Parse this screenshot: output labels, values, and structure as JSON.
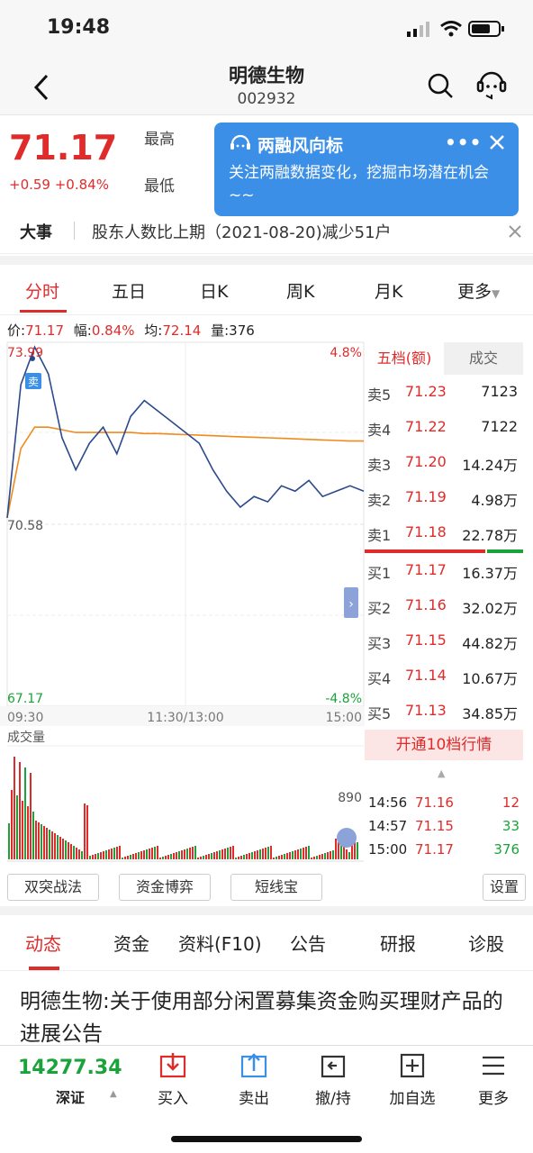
{
  "status_bar": {
    "time": "19:48"
  },
  "header": {
    "name": "明德生物",
    "code": "002932"
  },
  "quote": {
    "price": "71.17",
    "change": "+0.59 +0.84%",
    "high_label": "最高",
    "low_label": "最低"
  },
  "popup": {
    "title": "两融风向标",
    "text": "关注两融数据变化，挖掘市场潜在机会~~"
  },
  "news_bar": {
    "tag": "大事",
    "text": "股东人数比上期（2021-08-20)减少51户"
  },
  "chart_tabs": [
    "分时",
    "五日",
    "日K",
    "周K",
    "月K",
    "更多"
  ],
  "info_line": {
    "price_label": "价:",
    "price": "71.17",
    "amp_label": "幅:",
    "amp": "0.84%",
    "avg_label": "均:",
    "avg": "72.14",
    "vol_label": "量:",
    "vol": "376"
  },
  "chart": {
    "y_max": "73.99",
    "y_mid": "70.58",
    "y_min": "67.17",
    "pct_max": "4.8%",
    "pct_min": "-4.8%",
    "x_start": "09:30",
    "x_mid": "11:30/13:00",
    "x_end": "15:00",
    "sell_marker": "卖",
    "volume_label": "成交量",
    "volume_max": "890",
    "colors": {
      "price_line": "#2b4a8c",
      "avg_line": "#f08a1e",
      "up": "#e02b2b",
      "down": "#1aa33a"
    }
  },
  "chart_data": {
    "type": "line",
    "x_range": [
      "09:30",
      "15:00"
    ],
    "ylim": [
      67.17,
      73.99
    ],
    "series": [
      {
        "values": [
          70.7,
          73.2,
          73.9,
          73.4,
          72.2,
          71.6,
          72.1,
          72.4,
          71.9,
          72.6,
          72.9,
          72.7,
          72.5,
          72.3,
          72.1,
          71.6,
          71.2,
          70.9,
          71.1,
          71.0,
          71.3,
          71.2,
          71.4,
          71.1,
          71.2,
          71.3,
          71.2
        ]
      },
      {
        "values": [
          70.7,
          72.0,
          72.4,
          72.4,
          72.35,
          72.3,
          72.3,
          72.3,
          72.3,
          72.3,
          72.28,
          72.28,
          72.27,
          72.26,
          72.25,
          72.24,
          72.23,
          72.22,
          72.21,
          72.2,
          72.19,
          72.18,
          72.17,
          72.16,
          72.15,
          72.14,
          72.14
        ]
      }
    ]
  },
  "order_book": {
    "tab_active": "五档(额)",
    "tab_other": "成交",
    "sells": [
      {
        "label": "卖5",
        "price": "71.23",
        "volume": "7123"
      },
      {
        "label": "卖4",
        "price": "71.22",
        "volume": "7122"
      },
      {
        "label": "卖3",
        "price": "71.20",
        "volume": "14.24万"
      },
      {
        "label": "卖2",
        "price": "71.19",
        "volume": "4.98万"
      },
      {
        "label": "卖1",
        "price": "71.18",
        "volume": "22.78万"
      }
    ],
    "buys": [
      {
        "label": "买1",
        "price": "71.17",
        "volume": "16.37万"
      },
      {
        "label": "买2",
        "price": "71.16",
        "volume": "32.02万"
      },
      {
        "label": "买3",
        "price": "71.15",
        "volume": "44.82万"
      },
      {
        "label": "买4",
        "price": "71.14",
        "volume": "10.67万"
      },
      {
        "label": "买5",
        "price": "71.13",
        "volume": "34.85万"
      }
    ],
    "open10": "开通10档行情",
    "ticks": [
      {
        "time": "14:56",
        "price": "71.16",
        "volume": "12",
        "dir": "up"
      },
      {
        "time": "14:57",
        "price": "71.15",
        "volume": "33",
        "dir": "down"
      },
      {
        "time": "15:00",
        "price": "71.17",
        "volume": "376",
        "dir": "down"
      }
    ]
  },
  "tools": {
    "b1": "双突战法",
    "b2": "资金博弈",
    "b3": "短线宝",
    "settings": "设置"
  },
  "news_tabs": [
    "动态",
    "资金",
    "资料(F10)",
    "公告",
    "研报",
    "诊股"
  ],
  "article": {
    "title": "明德生物:关于使用部分闲置募集资金购买理财产品的进展公告"
  },
  "toolbar": {
    "index_value": "14277.34",
    "index_name": "深证",
    "buy": "买入",
    "sell": "卖出",
    "cancel": "撤/持",
    "add": "加自选",
    "more": "更多"
  }
}
